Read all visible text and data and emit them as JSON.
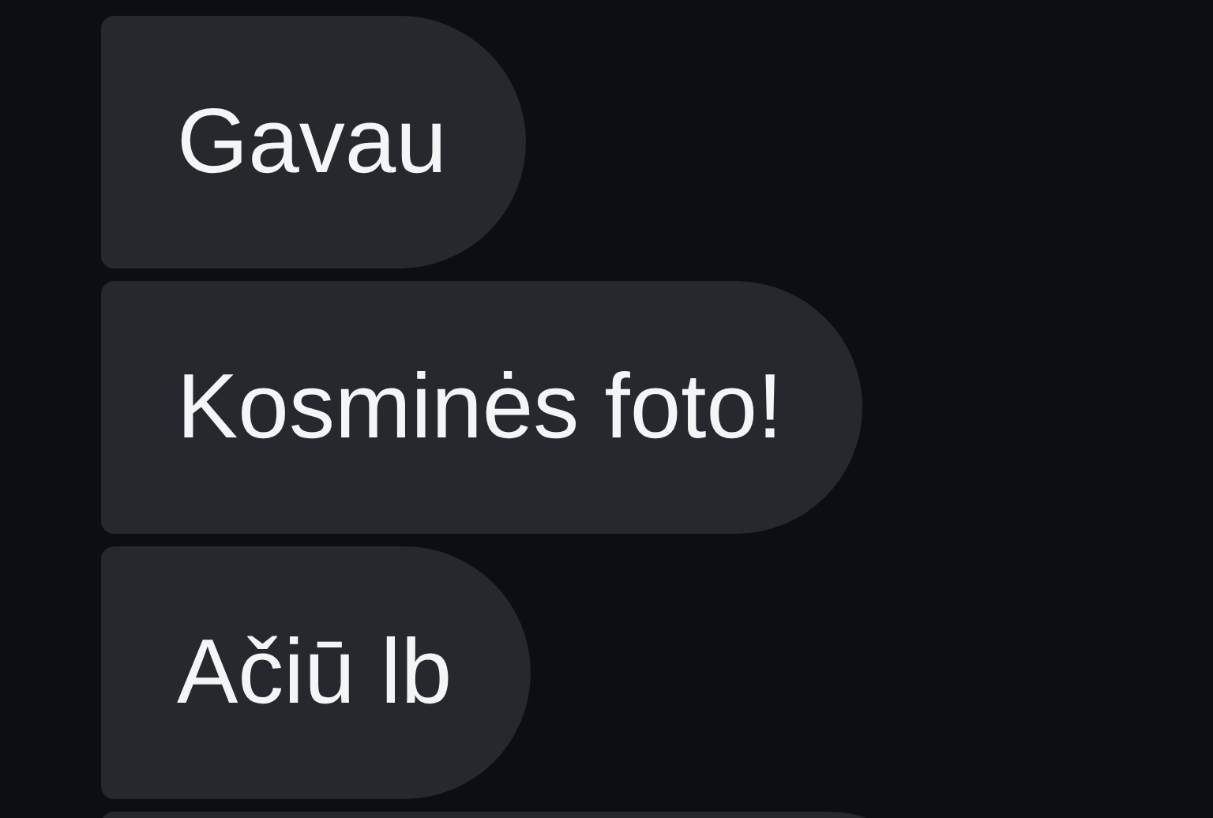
{
  "messages": [
    {
      "text": "Gavau"
    },
    {
      "text": "Kosminės foto!"
    },
    {
      "text": "Ačiū lb"
    }
  ]
}
